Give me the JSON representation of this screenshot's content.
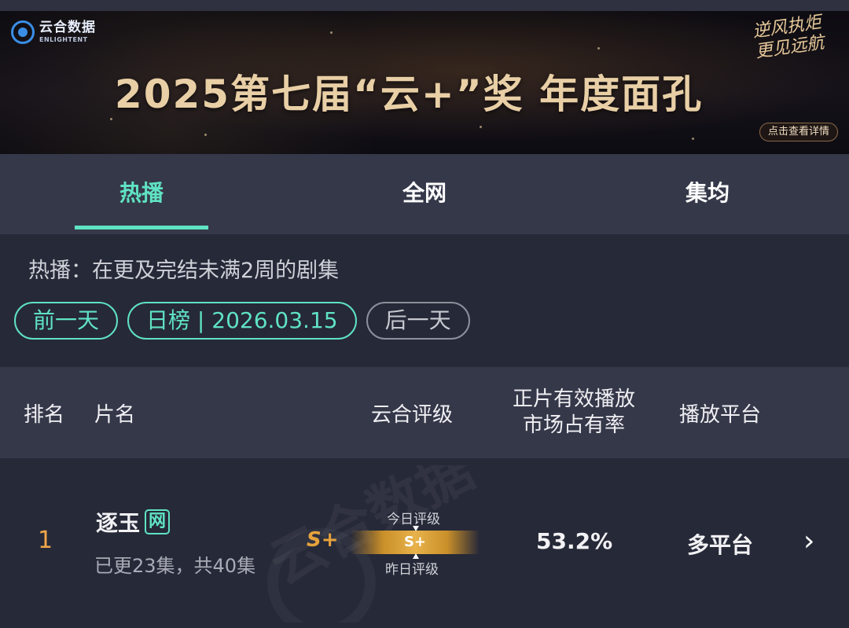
{
  "banner": {
    "logo_cn": "云合数据",
    "logo_en": "ENLIGHTENT",
    "title": "2025第七届“云+”奖 年度面孔",
    "slogan": "逆风执炬 更见远航",
    "detail_button": "点击查看详情"
  },
  "tabs": [
    {
      "label": "热播",
      "active": true
    },
    {
      "label": "全网",
      "active": false
    },
    {
      "label": "集均",
      "active": false
    }
  ],
  "description": "热播：在更及完结未满2周的剧集",
  "date_nav": {
    "prev": "前一天",
    "current": "日榜 | 2026.03.15",
    "next": "后一天"
  },
  "table": {
    "headers": {
      "rank": "排名",
      "name": "片名",
      "grade": "云合评级",
      "share": "正片有效播放 市场占有率",
      "platform": "播放平台"
    },
    "rows": [
      {
        "rank": "1",
        "title": "逐玉",
        "badge": "网",
        "episodes": "已更23集，共40集",
        "grade": "S+",
        "grade_today_label": "今日评级",
        "grade_bar": "S+",
        "grade_yesterday_label": "昨日评级",
        "share": "53.2%",
        "platform": "多平台"
      }
    ]
  },
  "watermark": "云合数据",
  "colors": {
    "accent": "#5fe3c3",
    "rank": "#f0a64a",
    "grade": "#e6a23c",
    "background": "#262938",
    "panel": "#353849"
  }
}
